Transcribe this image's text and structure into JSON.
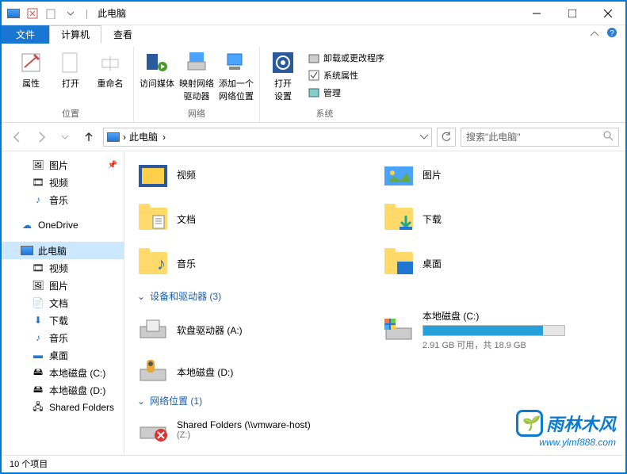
{
  "title": "此电脑",
  "tabs": {
    "file": "文件",
    "computer": "计算机",
    "view": "查看"
  },
  "ribbon": {
    "group_location": {
      "label": "位置",
      "properties": "属性",
      "open": "打开",
      "rename": "重命名"
    },
    "group_network": {
      "label": "网络",
      "access_media": "访问媒体",
      "map_drive": "映射网络\n驱动器",
      "add_location": "添加一个\n网络位置"
    },
    "group_system": {
      "label": "系统",
      "open_settings": "打开\n设置",
      "uninstall": "卸载或更改程序",
      "properties": "系统属性",
      "manage": "管理"
    }
  },
  "breadcrumb": {
    "root": "此电脑"
  },
  "search_placeholder": "搜索\"此电脑\"",
  "nav": {
    "pictures": "图片",
    "videos": "视频",
    "music": "音乐",
    "onedrive": "OneDrive",
    "this_pc": "此电脑",
    "videos2": "视频",
    "pictures2": "图片",
    "documents": "文档",
    "downloads": "下载",
    "music2": "音乐",
    "desktop": "桌面",
    "drive_c": "本地磁盘 (C:)",
    "drive_d": "本地磁盘 (D:)",
    "shared": "Shared Folders"
  },
  "content": {
    "folders": {
      "videos": "视频",
      "pictures": "图片",
      "documents": "文档",
      "downloads": "下载",
      "music": "音乐",
      "desktop": "桌面"
    },
    "devices_header": "设备和驱动器 (3)",
    "drive_a": "软盘驱动器 (A:)",
    "drive_c": {
      "name": "本地磁盘 (C:)",
      "sub": "2.91 GB 可用，共 18.9 GB",
      "fill_pct": 85
    },
    "drive_d": "本地磁盘 (D:)",
    "network_header": "网络位置 (1)",
    "shared": {
      "name": "Shared Folders (\\\\vmware-host)",
      "letter": "(Z:)"
    }
  },
  "status": "10 个项目",
  "watermark": {
    "text": "雨林木风",
    "url": "www.ylmf888.com"
  }
}
